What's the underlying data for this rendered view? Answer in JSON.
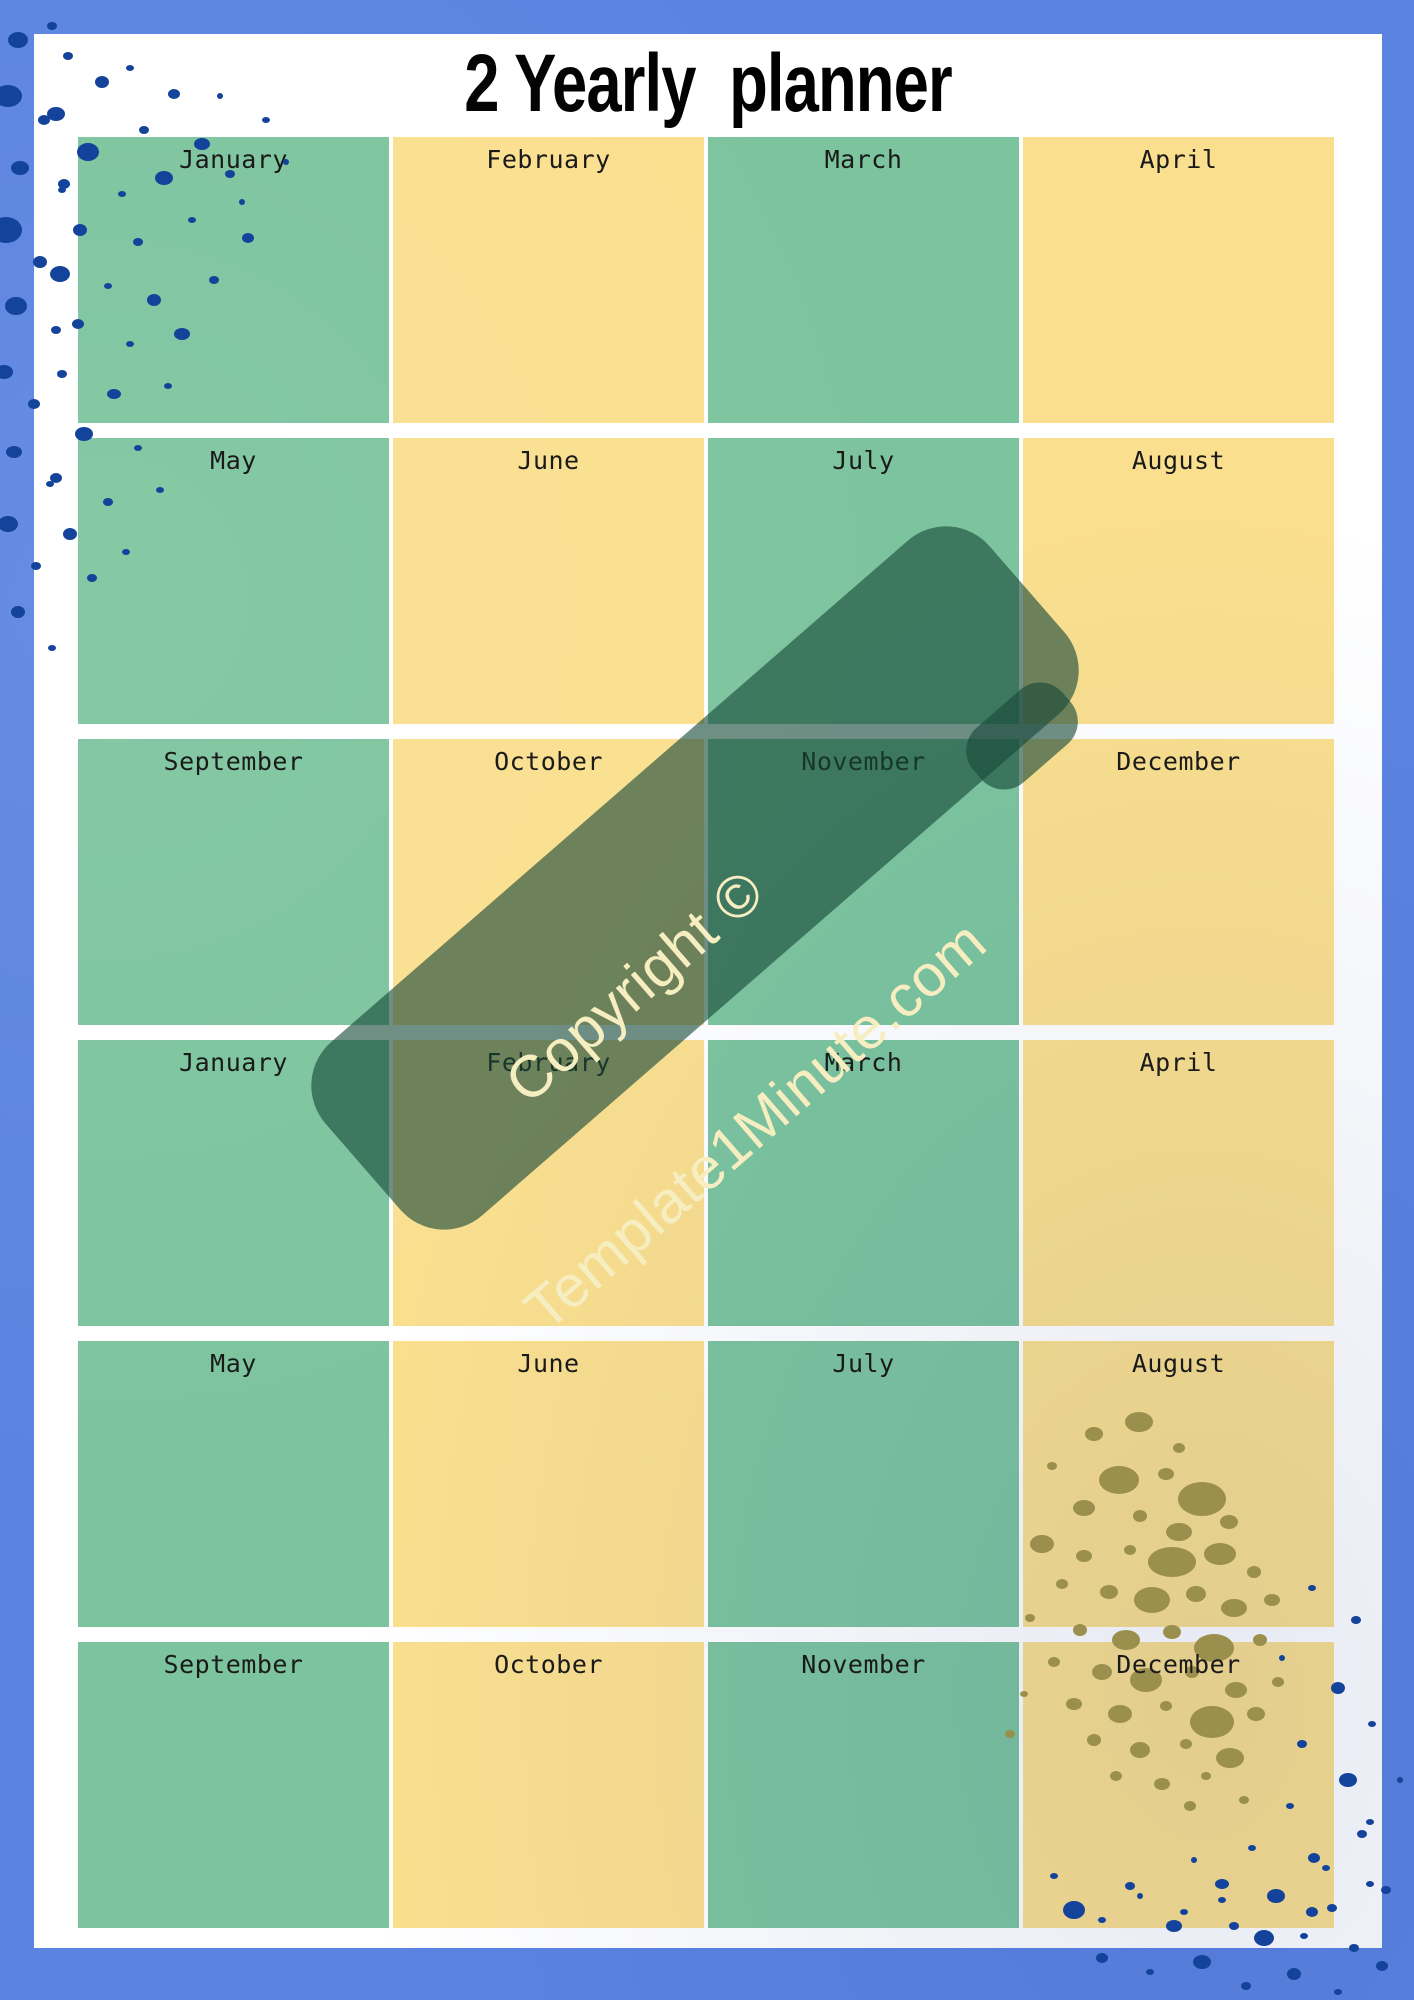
{
  "page": {
    "title": "2 Yearly  planner",
    "border_color": "#5b83e0",
    "sheet_color": "#ffffff",
    "green_cell_color": "#7cc49e",
    "yellow_cell_color": "#fadf8e",
    "splatter_blue_color": "#13439a",
    "splatter_gold_color": "#9b8f4e"
  },
  "calendar": {
    "columns": 4,
    "rows": 6,
    "cells": [
      {
        "label": "January",
        "color": "green"
      },
      {
        "label": "February",
        "color": "yellow"
      },
      {
        "label": "March",
        "color": "green"
      },
      {
        "label": "April",
        "color": "yellow"
      },
      {
        "label": "May",
        "color": "green"
      },
      {
        "label": "June",
        "color": "yellow"
      },
      {
        "label": "July",
        "color": "green"
      },
      {
        "label": "August",
        "color": "yellow"
      },
      {
        "label": "September",
        "color": "green"
      },
      {
        "label": "October",
        "color": "yellow"
      },
      {
        "label": "November",
        "color": "green"
      },
      {
        "label": "December",
        "color": "yellow"
      },
      {
        "label": "January",
        "color": "green"
      },
      {
        "label": "February",
        "color": "yellow"
      },
      {
        "label": "March",
        "color": "green"
      },
      {
        "label": "April",
        "color": "yellow"
      },
      {
        "label": "May",
        "color": "green"
      },
      {
        "label": "June",
        "color": "yellow"
      },
      {
        "label": "July",
        "color": "green"
      },
      {
        "label": "August",
        "color": "yellow"
      },
      {
        "label": "September",
        "color": "green"
      },
      {
        "label": "October",
        "color": "yellow"
      },
      {
        "label": "November",
        "color": "green"
      },
      {
        "label": "December",
        "color": "yellow"
      }
    ]
  },
  "watermark": {
    "line1": "Copyright ©",
    "line2": "Template1Minute.com",
    "band_color": "rgba(22, 72, 56, 0.62)",
    "text_color": "#f6eec0",
    "rotation_deg": -41
  }
}
